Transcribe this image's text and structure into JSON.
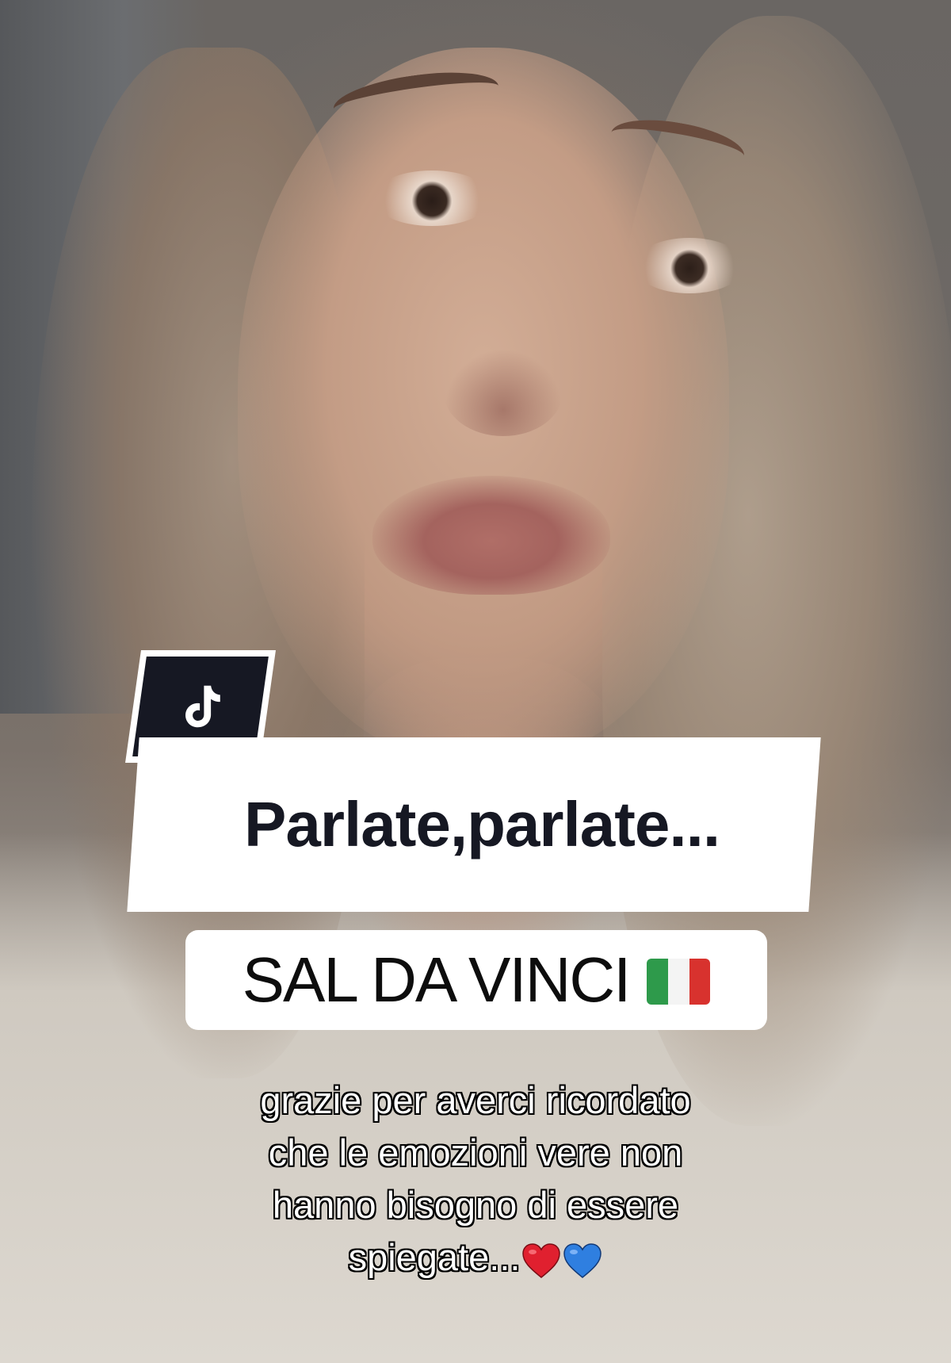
{
  "logo": {
    "icon": "tiktok-note-icon",
    "color": "#161823"
  },
  "title": {
    "text": "Parlate,parlate..."
  },
  "subtitle": {
    "text": "SAL DA VINCI",
    "flag_icon": "italy-flag-icon",
    "flag_colors": [
      "#2e9a4b",
      "#f4f4f4",
      "#d8322e"
    ]
  },
  "caption": {
    "lines": [
      "grazie per averci ricordato",
      "che le emozioni vere non",
      "hanno bisogno di essere",
      "spiegate..."
    ],
    "emoji": [
      {
        "icon": "red-heart-icon",
        "color": "#e0202f"
      },
      {
        "icon": "blue-heart-icon",
        "color": "#2f7fe0"
      }
    ]
  }
}
